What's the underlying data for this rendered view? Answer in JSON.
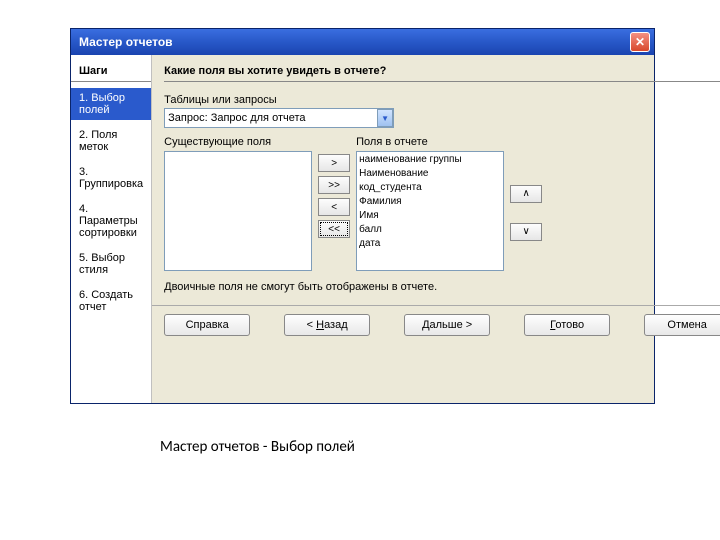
{
  "window": {
    "title": "Мастер отчетов",
    "close": "✕"
  },
  "sidebar": {
    "header": "Шаги",
    "steps": [
      "1. Выбор полей",
      "2. Поля меток",
      "3. Группировка",
      "4. Параметры сортировки",
      "5. Выбор стиля",
      "6. Создать отчет"
    ],
    "active_index": 0
  },
  "main": {
    "header": "Какие поля вы хотите увидеть в отчете?",
    "tables_label": "Таблицы или запросы",
    "combo_value": "Запрос: Запрос для отчета",
    "available_label": "Существующие поля",
    "selected_label": "Поля в отчете",
    "available_items": [],
    "selected_items": [
      "наименование группы",
      "Наименование",
      "код_студента",
      "Фамилия",
      "Имя",
      "балл",
      "дата"
    ],
    "transfer": {
      "add": ">",
      "add_all": ">>",
      "remove": "<",
      "remove_all": "<<"
    },
    "reorder": {
      "up": "∧",
      "down": "∨"
    },
    "hint": "Двоичные поля не смогут быть отображены в отчете."
  },
  "buttons": {
    "help": "Справка",
    "back": "< Назад",
    "next": "Дальше >",
    "finish": "Готово",
    "cancel": "Отмена"
  },
  "caption": "Мастер отчетов - Выбор полей"
}
